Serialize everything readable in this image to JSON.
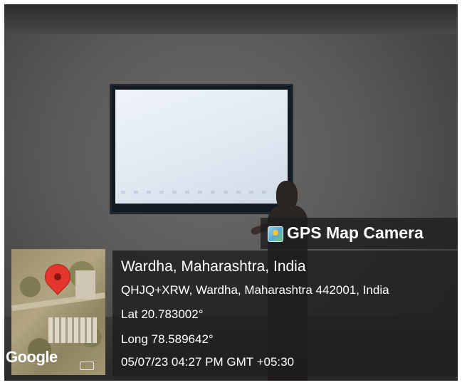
{
  "overlay": {
    "app_name": "GPS Map Camera",
    "app_icon": "gps-map-camera-icon",
    "location_title": "Wardha, Maharashtra, India",
    "address": "QHJQ+XRW, Wardha, Maharashtra 442001, India",
    "latitude": "Lat 20.783002°",
    "longitude": "Long 78.589642°",
    "datetime": "05/07/23 04:27 PM GMT +05:30"
  },
  "map": {
    "attribution": "Google",
    "marker_icon": "map-pin-icon",
    "marker_color": "#e3372e"
  },
  "colors": {
    "overlay_background": "#1e1e1e",
    "overlay_text": "#ffffff"
  }
}
